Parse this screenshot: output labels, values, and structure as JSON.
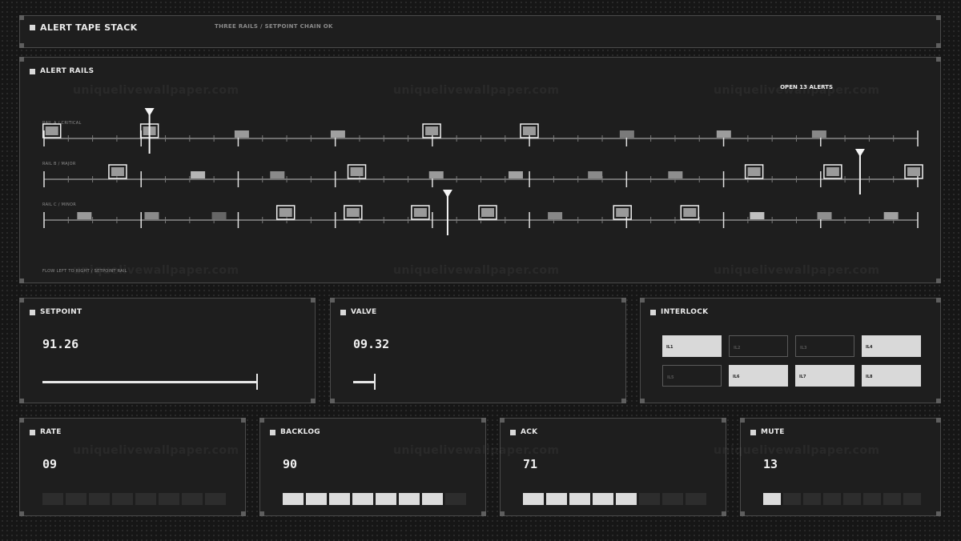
{
  "header": {
    "title": "ALERT TAPE STACK",
    "subtitle": "THREE RAILS / SETPOINT CHAIN OK"
  },
  "alert_rails": {
    "title": "ALERT RAILS",
    "open_alerts": "OPEN 13 ALERTS",
    "footer": "FLOW LEFT TO RIGHT / SETPOINT RAIL",
    "rails": [
      {
        "label": "RAIL A / CRITICAL",
        "marker": 0.134,
        "alerts": [
          {
            "pos": 0.005,
            "kind": "boxed"
          },
          {
            "pos": 0.134,
            "kind": "boxed"
          },
          {
            "pos": 0.256,
            "kind": "block",
            "shade": "#9a9a9a"
          },
          {
            "pos": 0.383,
            "kind": "block",
            "shade": "#a0a0a0"
          },
          {
            "pos": 0.507,
            "kind": "boxed"
          },
          {
            "pos": 0.636,
            "kind": "boxed"
          },
          {
            "pos": 0.765,
            "kind": "block",
            "shade": "#7a7a7a"
          },
          {
            "pos": 0.893,
            "kind": "block",
            "shade": "#9c9c9c"
          },
          {
            "pos": 1.019,
            "kind": "block",
            "shade": "#888888"
          }
        ]
      },
      {
        "label": "RAIL B / MAJOR",
        "marker": 1.073,
        "alerts": [
          {
            "pos": 0.092,
            "kind": "boxed"
          },
          {
            "pos": 0.198,
            "kind": "block",
            "shade": "#b5b5b5"
          },
          {
            "pos": 0.303,
            "kind": "block",
            "shade": "#8a8a8a"
          },
          {
            "pos": 0.408,
            "kind": "boxed"
          },
          {
            "pos": 0.513,
            "kind": "block",
            "shade": "#9a9a9a"
          },
          {
            "pos": 0.618,
            "kind": "block",
            "shade": "#a2a2a2"
          },
          {
            "pos": 0.723,
            "kind": "block",
            "shade": "#8a8a8a"
          },
          {
            "pos": 0.829,
            "kind": "block",
            "shade": "#8e8e8e"
          },
          {
            "pos": 0.933,
            "kind": "boxed"
          },
          {
            "pos": 1.037,
            "kind": "boxed"
          },
          {
            "pos": 1.144,
            "kind": "boxed"
          }
        ]
      },
      {
        "label": "RAIL C / MINOR",
        "marker": 0.528,
        "alerts": [
          {
            "pos": 0.048,
            "kind": "block",
            "shade": "#9a9a9a"
          },
          {
            "pos": 0.137,
            "kind": "block",
            "shade": "#8a8a8a"
          },
          {
            "pos": 0.226,
            "kind": "block",
            "shade": "#666666"
          },
          {
            "pos": 0.314,
            "kind": "boxed"
          },
          {
            "pos": 0.403,
            "kind": "boxed"
          },
          {
            "pos": 0.492,
            "kind": "boxed"
          },
          {
            "pos": 0.581,
            "kind": "boxed"
          },
          {
            "pos": 0.67,
            "kind": "block",
            "shade": "#888888"
          },
          {
            "pos": 0.759,
            "kind": "boxed"
          },
          {
            "pos": 0.848,
            "kind": "boxed"
          },
          {
            "pos": 0.937,
            "kind": "block",
            "shade": "#c0c0c0"
          },
          {
            "pos": 1.026,
            "kind": "block",
            "shade": "#8e8e8e"
          },
          {
            "pos": 1.114,
            "kind": "block",
            "shade": "#a0a0a0"
          }
        ]
      }
    ]
  },
  "setpoint": {
    "title": "SETPOINT",
    "value": "91.26",
    "fill": 0.91
  },
  "valve": {
    "title": "VALVE",
    "value": "09.32",
    "fill": 0.09
  },
  "interlock": {
    "title": "INTERLOCK",
    "items": [
      {
        "label": "IL1",
        "on": true
      },
      {
        "label": "IL2",
        "on": false
      },
      {
        "label": "IL3",
        "on": false
      },
      {
        "label": "IL4",
        "on": true
      },
      {
        "label": "IL5",
        "on": false
      },
      {
        "label": "IL6",
        "on": true
      },
      {
        "label": "IL7",
        "on": true
      },
      {
        "label": "IL8",
        "on": true
      }
    ]
  },
  "stats": [
    {
      "title": "RATE",
      "value": "09",
      "lit": 0,
      "total": 8
    },
    {
      "title": "BACKLOG",
      "value": "90",
      "lit": 7,
      "total": 8
    },
    {
      "title": "ACK",
      "value": "71",
      "lit": 5,
      "total": 8
    },
    {
      "title": "MUTE",
      "value": "13",
      "lit": 1,
      "total": 8
    }
  ],
  "watermark": "uniquelivewallpaper.com",
  "colors": {
    "accent": "#ffffff",
    "panel": "#1e1e1e",
    "border": "#4a4a4a",
    "segment_off": "#2d2d2d",
    "segment_on": "#dcdcdc"
  }
}
